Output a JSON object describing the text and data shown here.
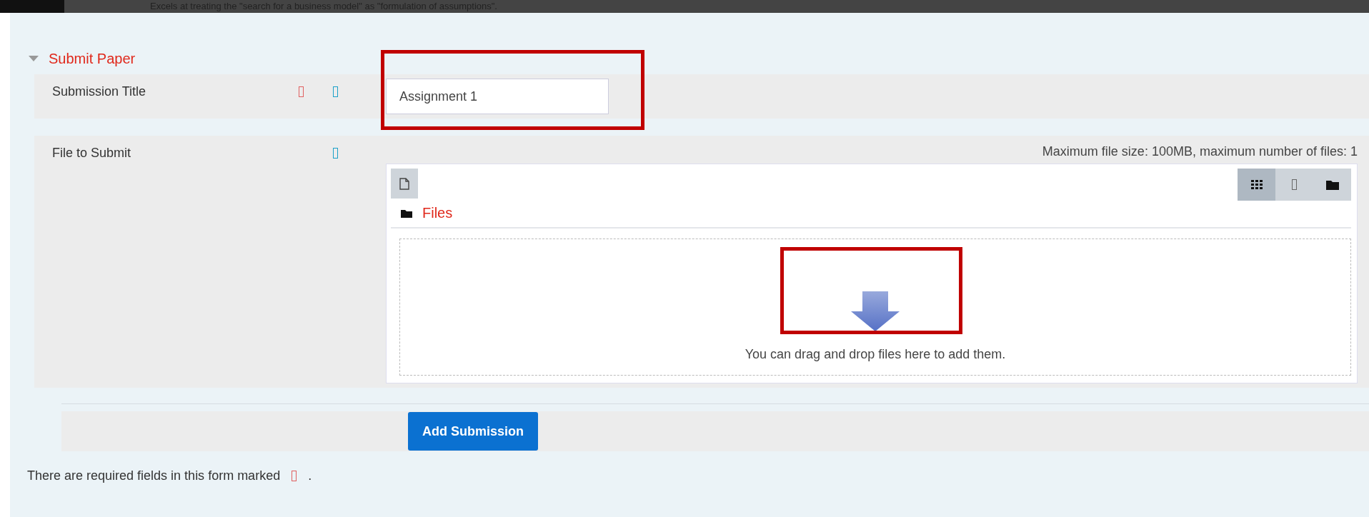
{
  "top_text": "Excels at treating the \"search for a business model\" as \"formulation of assumptions\".",
  "section": {
    "title": "Submit Paper",
    "expanded": true
  },
  "fields": [
    {
      "kind": "text",
      "label": "Submission Title",
      "required": true,
      "value": "Assignment 1"
    },
    {
      "kind": "file",
      "label": "File to Submit",
      "required": false,
      "limits": "Maximum file size: 100MB, maximum number of files: 1",
      "folder_label": "Files",
      "drop_hint": "You can drag and drop files here to add them.",
      "views": [
        {
          "kind": "icons",
          "selected": true
        },
        {
          "kind": "list",
          "selected": false
        },
        {
          "kind": "tree",
          "selected": false
        }
      ]
    }
  ],
  "submit_button": "Add Submission",
  "footer": {
    "before": "There are required fields in this form marked",
    "after": "."
  }
}
